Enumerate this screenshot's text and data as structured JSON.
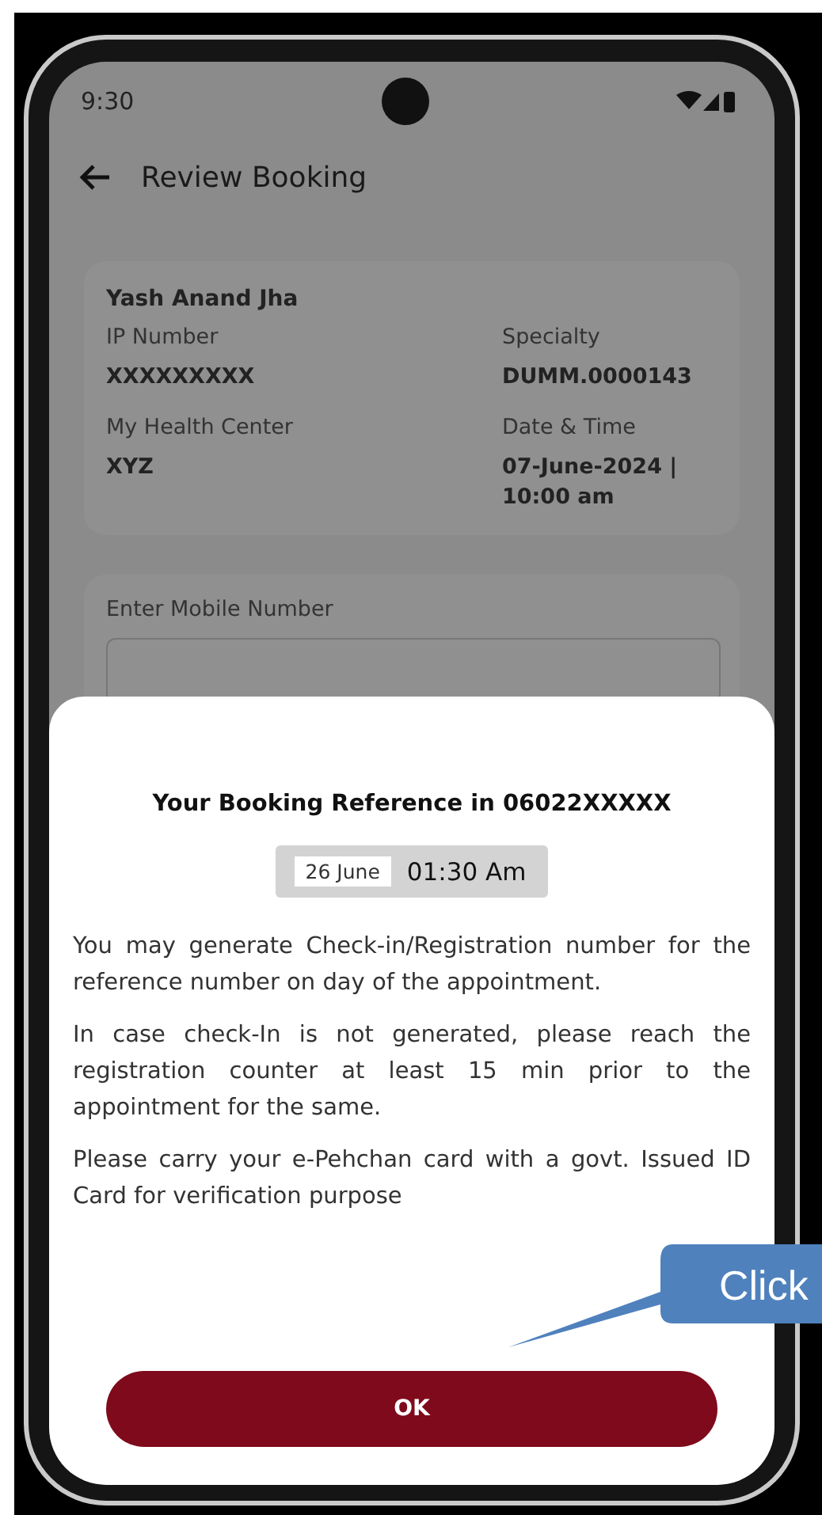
{
  "status_bar": {
    "time": "9:30"
  },
  "header": {
    "title": "Review Booking"
  },
  "patient": {
    "name": "Yash Anand Jha",
    "fields": [
      {
        "label": "IP Number",
        "value": "XXXXXXXXX"
      },
      {
        "label": "Specialty",
        "value": "DUMM.0000143"
      },
      {
        "label": "My Health Center",
        "value": "XYZ"
      },
      {
        "label": "Date & Time",
        "value": "07-June-2024 | 10:00 am"
      }
    ]
  },
  "mobile": {
    "label": "Enter Mobile Number"
  },
  "dialog": {
    "title": "Your Booking Reference in 06022XXXXX",
    "date": "26 June",
    "time": "01:30 Am",
    "paragraphs": [
      "You may generate Check-in/Registration number for the reference number on day of the appointment.",
      "In case check-In is not generated, please reach the  registration counter at least 15 min prior to the appointment for the same.",
      "Please carry your e-Pehchan card with a govt. Issued ID Card for verification purpose"
    ],
    "button": "OK"
  },
  "callout": {
    "text": "Click"
  }
}
